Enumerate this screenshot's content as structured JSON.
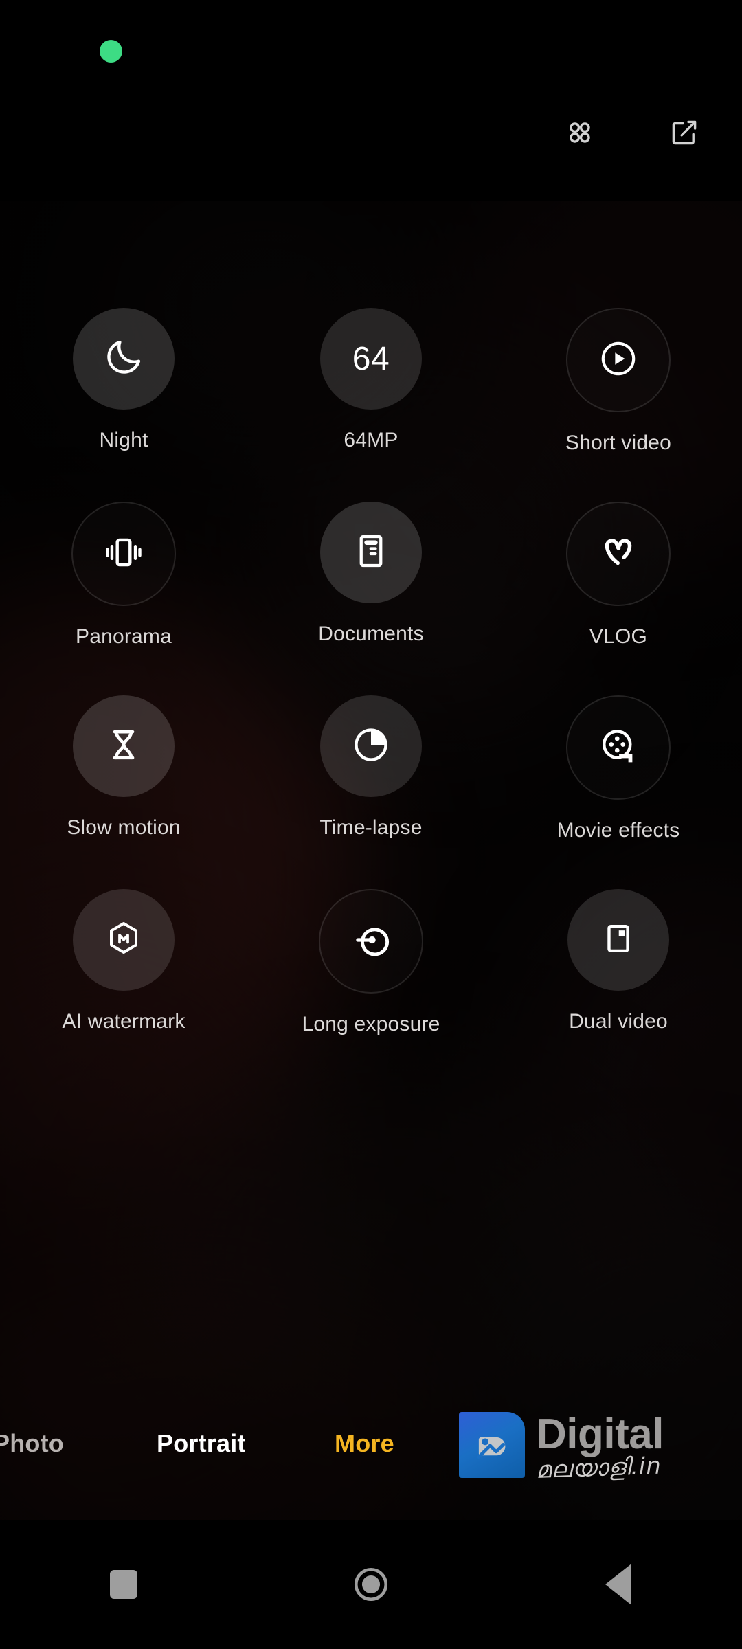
{
  "status_bar": {
    "privacy_indicator": "camera-in-use-dot",
    "privacy_color": "#3ddc84",
    "icons": [
      {
        "name": "grid-dots-icon",
        "label": "Modes grid"
      },
      {
        "name": "edit-compose-icon",
        "label": "Customize modes"
      }
    ]
  },
  "mode_grid": {
    "rows": [
      [
        {
          "label": "Night",
          "icon": "moon-icon",
          "style": "fill-strong"
        },
        {
          "label": "64MP",
          "icon": "megapixel-text",
          "style": "fill-mid",
          "icon_text": "64"
        },
        {
          "label": "Short video",
          "icon": "play-circle-icon",
          "style": "outline"
        }
      ],
      [
        {
          "label": "Panorama",
          "icon": "panorama-phone-icon",
          "style": "outline"
        },
        {
          "label": "Documents",
          "icon": "document-icon",
          "style": "fill-strong"
        },
        {
          "label": "VLOG",
          "icon": "vlog-v-icon",
          "style": "outline"
        }
      ],
      [
        {
          "label": "Slow motion",
          "icon": "hourglass-icon",
          "style": "fill-strong"
        },
        {
          "label": "Time-lapse",
          "icon": "timelapse-icon",
          "style": "fill-mid"
        },
        {
          "label": "Movie effects",
          "icon": "film-reel-icon",
          "style": "outline"
        }
      ],
      [
        {
          "label": "AI watermark",
          "icon": "hexagon-m-icon",
          "style": "fill-mid"
        },
        {
          "label": "Long exposure",
          "icon": "long-exposure-icon",
          "style": "outline"
        },
        {
          "label": "Dual video",
          "icon": "dual-video-icon",
          "style": "fill-mid"
        }
      ]
    ]
  },
  "mode_strip": {
    "items": [
      {
        "label": "Photo",
        "state": "inactive"
      },
      {
        "label": "Portrait",
        "state": "inactive"
      },
      {
        "label": "More",
        "state": "active"
      }
    ],
    "active_color": "#f5b521"
  },
  "watermark": {
    "logo": "digital-malayali-logo",
    "title": "Digital",
    "subtitle": "മലയാളി.in"
  },
  "nav_bar": {
    "buttons": [
      {
        "name": "recents-button",
        "icon": "square-icon"
      },
      {
        "name": "home-button",
        "icon": "circle-icon"
      },
      {
        "name": "back-button",
        "icon": "triangle-left-icon"
      }
    ]
  }
}
